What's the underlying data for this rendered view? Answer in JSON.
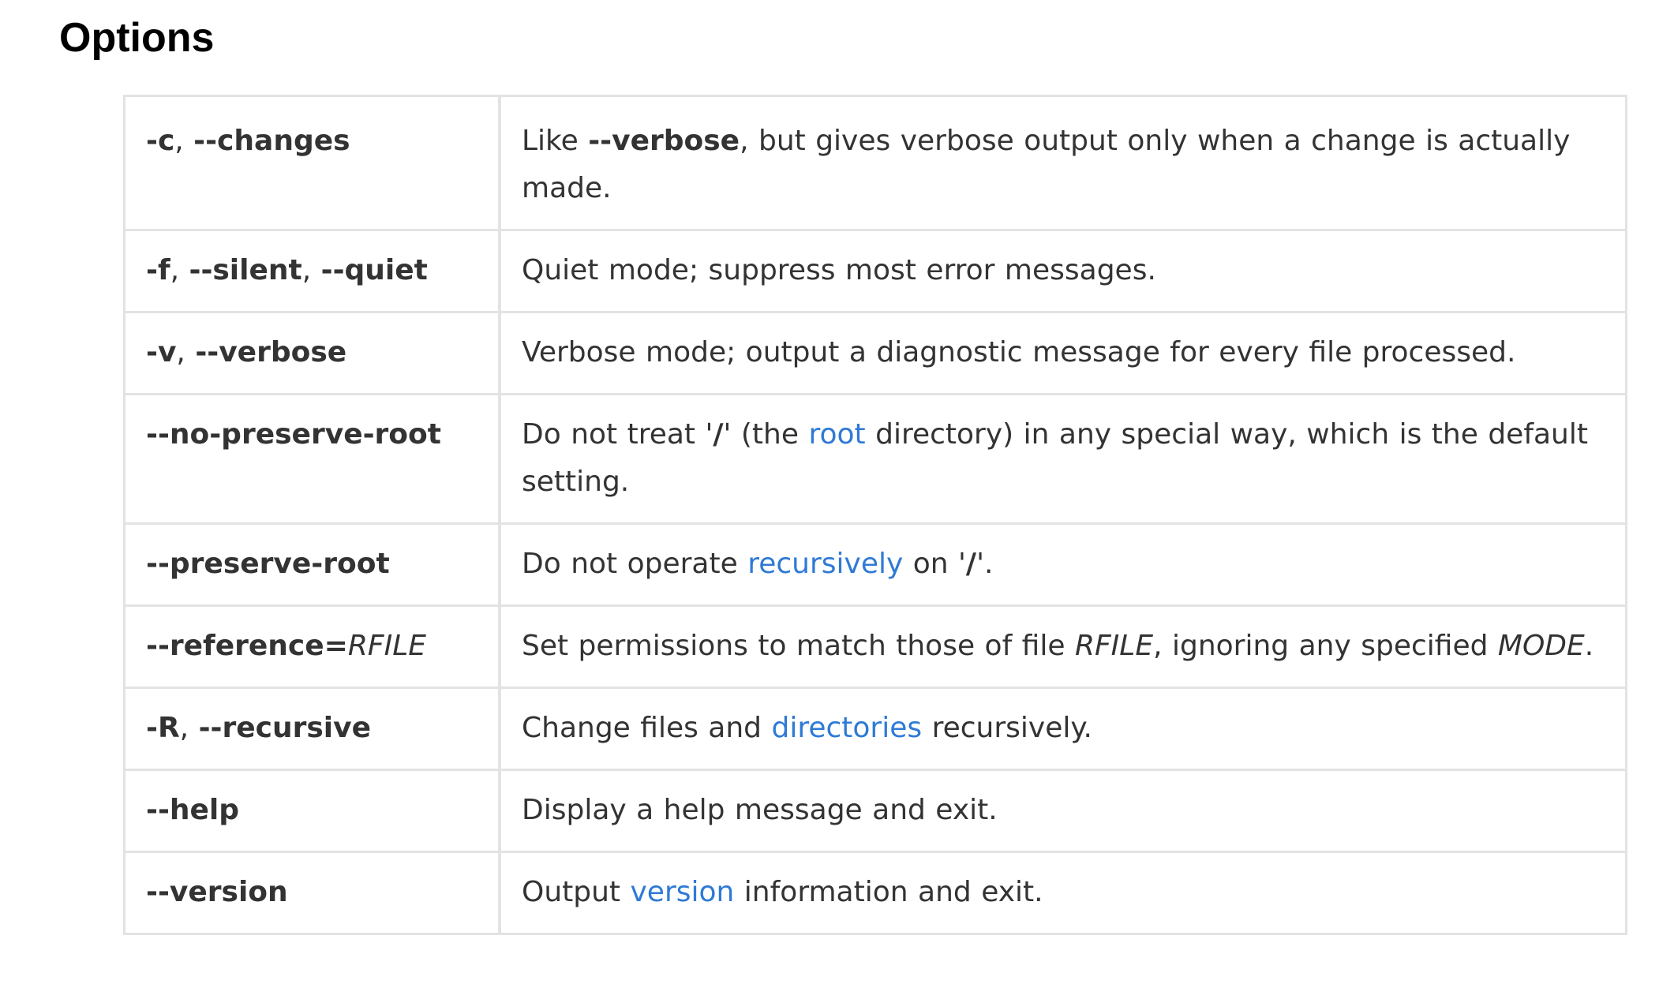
{
  "heading": "Options",
  "colors": {
    "link": "#2f7ad6",
    "border": "#e3e3e3",
    "text": "#333333",
    "heading": "#000000"
  },
  "rows": [
    {
      "option": [
        {
          "t": "-c",
          "s": "b"
        },
        {
          "t": ", "
        },
        {
          "t": "--changes",
          "s": "b"
        }
      ],
      "description": [
        {
          "t": "Like "
        },
        {
          "t": "--verbose",
          "s": "b"
        },
        {
          "t": ", but gives verbose output only when a change is actually made."
        }
      ]
    },
    {
      "option": [
        {
          "t": "-f",
          "s": "b"
        },
        {
          "t": ", "
        },
        {
          "t": "--silent",
          "s": "b"
        },
        {
          "t": ", "
        },
        {
          "t": "--quiet",
          "s": "b"
        }
      ],
      "description": [
        {
          "t": "Quiet mode; suppress most error messages."
        }
      ]
    },
    {
      "option": [
        {
          "t": "-v",
          "s": "b"
        },
        {
          "t": ", "
        },
        {
          "t": "--verbose",
          "s": "b"
        }
      ],
      "description": [
        {
          "t": "Verbose mode; output a diagnostic message for every file processed."
        }
      ]
    },
    {
      "option": [
        {
          "t": "--no-preserve-root",
          "s": "b"
        }
      ],
      "description": [
        {
          "t": "Do not treat '"
        },
        {
          "t": "/",
          "s": "b"
        },
        {
          "t": "' (the "
        },
        {
          "t": "root",
          "s": "a"
        },
        {
          "t": " directory) in any special way, which is the default setting."
        }
      ]
    },
    {
      "option": [
        {
          "t": "--preserve-root",
          "s": "b"
        }
      ],
      "description": [
        {
          "t": "Do not operate "
        },
        {
          "t": "recursively",
          "s": "a"
        },
        {
          "t": " on '"
        },
        {
          "t": "/",
          "s": "b"
        },
        {
          "t": "'."
        }
      ]
    },
    {
      "option": [
        {
          "t": "--reference=",
          "s": "b"
        },
        {
          "t": "RFILE",
          "s": "i"
        }
      ],
      "description": [
        {
          "t": "Set permissions to match those of file "
        },
        {
          "t": "RFILE",
          "s": "i"
        },
        {
          "t": ", ignoring any specified "
        },
        {
          "t": "MODE",
          "s": "i"
        },
        {
          "t": "."
        }
      ]
    },
    {
      "option": [
        {
          "t": "-R",
          "s": "b"
        },
        {
          "t": ", "
        },
        {
          "t": "--recursive",
          "s": "b"
        }
      ],
      "description": [
        {
          "t": "Change files and "
        },
        {
          "t": "directories",
          "s": "a"
        },
        {
          "t": " recursively."
        }
      ]
    },
    {
      "option": [
        {
          "t": "--help",
          "s": "b"
        }
      ],
      "description": [
        {
          "t": "Display a help message and exit."
        }
      ]
    },
    {
      "option": [
        {
          "t": "--version",
          "s": "b"
        }
      ],
      "description": [
        {
          "t": "Output "
        },
        {
          "t": "version",
          "s": "a"
        },
        {
          "t": " information and exit."
        }
      ]
    }
  ]
}
